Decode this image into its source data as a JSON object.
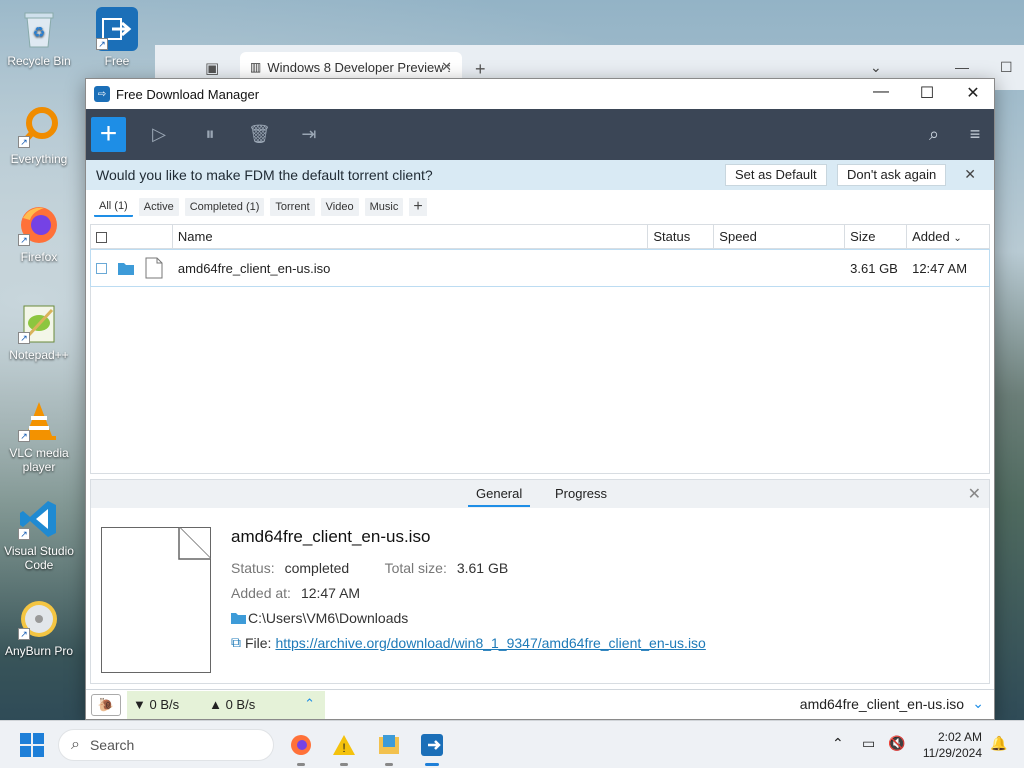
{
  "desktop": {
    "icons": [
      {
        "label": "Recycle Bin",
        "icon": "recycle-bin-icon"
      },
      {
        "label": "Free",
        "icon": "fdm-icon"
      },
      {
        "label": "Everything",
        "icon": "everything-icon"
      },
      {
        "label": "Firefox",
        "icon": "firefox-icon"
      },
      {
        "label": "Notepad++",
        "icon": "notepadpp-icon"
      },
      {
        "label": "VLC media player",
        "icon": "vlc-icon"
      },
      {
        "label": "Visual Studio Code",
        "icon": "vscode-icon"
      },
      {
        "label": "AnyBurn Pro",
        "icon": "anyburn-icon"
      }
    ]
  },
  "browser": {
    "tab_title": "Windows 8 Developer Preview :"
  },
  "fdm": {
    "title": "Free Download Manager",
    "toolbar": {
      "add": "+",
      "icons": [
        "play-icon",
        "pause-icon",
        "delete-icon",
        "move-icon",
        "search-icon",
        "menu-icon"
      ]
    },
    "infobar": {
      "message": "Would you like to make FDM the default torrent client?",
      "set_default": "Set as Default",
      "dont_ask": "Don't ask again"
    },
    "filters": [
      "All (1)",
      "Active",
      "Completed (1)",
      "Torrent",
      "Video",
      "Music"
    ],
    "table": {
      "columns": [
        "Name",
        "Status",
        "Speed",
        "Size",
        "Added"
      ],
      "rows": [
        {
          "name": "amd64fre_client_en-us.iso",
          "status": "",
          "speed": "",
          "size": "3.61 GB",
          "added": "12:47 AM"
        }
      ]
    },
    "details": {
      "tabs": [
        "General",
        "Progress"
      ],
      "file_name": "amd64fre_client_en-us.iso",
      "status_label": "Status:",
      "status_value": "completed",
      "total_label": "Total size:",
      "total_value": "3.61 GB",
      "added_label": "Added at:",
      "added_value": "12:47 AM",
      "path": "C:\\Users\\VM6\\Downloads",
      "file_label": "File:",
      "file_url": "https://archive.org/download/win8_1_9347/amd64fre_client_en-us.iso"
    },
    "statusbar": {
      "down": "0 B/s",
      "up": "0 B/s",
      "current_file": "amd64fre_client_en-us.iso"
    }
  },
  "taskbar": {
    "search_placeholder": "Search",
    "time": "2:02 AM",
    "date": "11/29/2024"
  },
  "colors": {
    "accent": "#1e8ee6",
    "toolbar_bg": "#3b4656",
    "infobar_bg": "#d9eaf4"
  }
}
